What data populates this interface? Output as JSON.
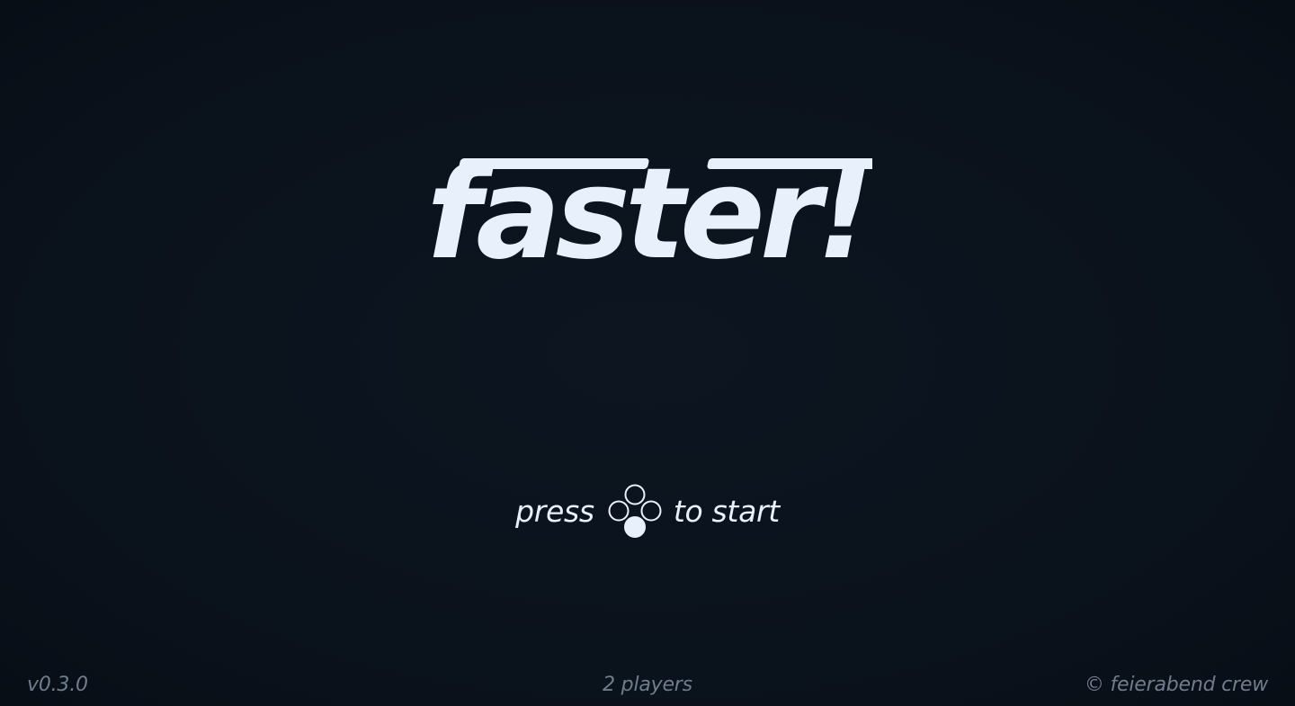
{
  "title": {
    "logo_text": "faster!"
  },
  "start_prompt": {
    "before": "press",
    "after": "to start",
    "button_icon": "gamepad-face-buttons-bottom-icon"
  },
  "footer": {
    "version": "v0.3.0",
    "players": "2 players",
    "credits": "© feierabend crew"
  },
  "colors": {
    "background": "#0b131d",
    "foreground": "#e8f1fb",
    "muted": "#6f7d8c"
  }
}
